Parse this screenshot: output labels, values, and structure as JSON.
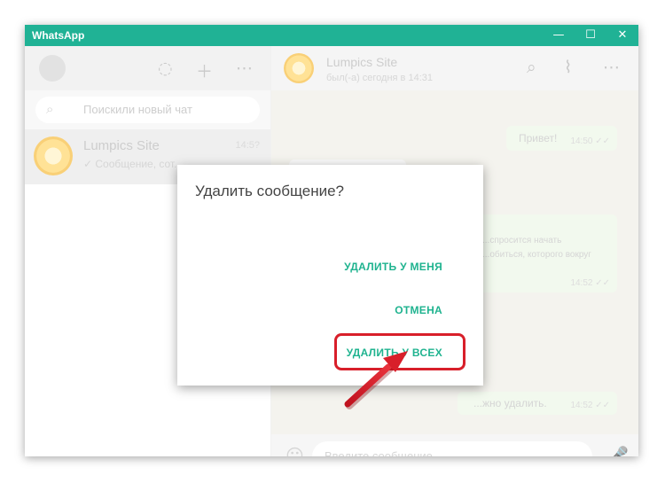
{
  "window": {
    "title": "WhatsApp",
    "minimize_glyph": "—",
    "maximize_glyph": "☐",
    "close_glyph": "✕"
  },
  "left_panel": {
    "search_placeholder": "Поискили новый чат",
    "chat": {
      "name": "Lumpics Site",
      "time": "14:5?",
      "preview": "✓ Сообщение, сот..."
    }
  },
  "chat_panel": {
    "contact_name": "Lumpics Site",
    "contact_status": "был(-а) сегодня в 14:31",
    "messages": [
      {
        "text": "Привет!",
        "time": "14:50 ✓✓"
      },
      {
        "text": "...спросится начать",
        "time": ""
      },
      {
        "text": "...обиться, которого вокруг",
        "time": "14:52 ✓✓"
      },
      {
        "text": "...жно удалить.",
        "time": "14:52 ✓✓"
      }
    ],
    "composer_placeholder": "Введите сообщение"
  },
  "dialog": {
    "title": "Удалить сообщение?",
    "delete_for_me": "УДАЛИТЬ У МЕНЯ",
    "cancel": "ОТМЕНА",
    "delete_for_everyone": "УДАЛИТЬ У ВСЕХ"
  },
  "colors": {
    "title_bar": "#20b295",
    "accent_green": "#1fb38f",
    "highlight_red": "#d81f2a"
  },
  "icons": [
    "status-icon",
    "new-chat-icon",
    "menu-icon",
    "search-icon",
    "attach-icon",
    "emoji-icon",
    "microphone-icon"
  ]
}
